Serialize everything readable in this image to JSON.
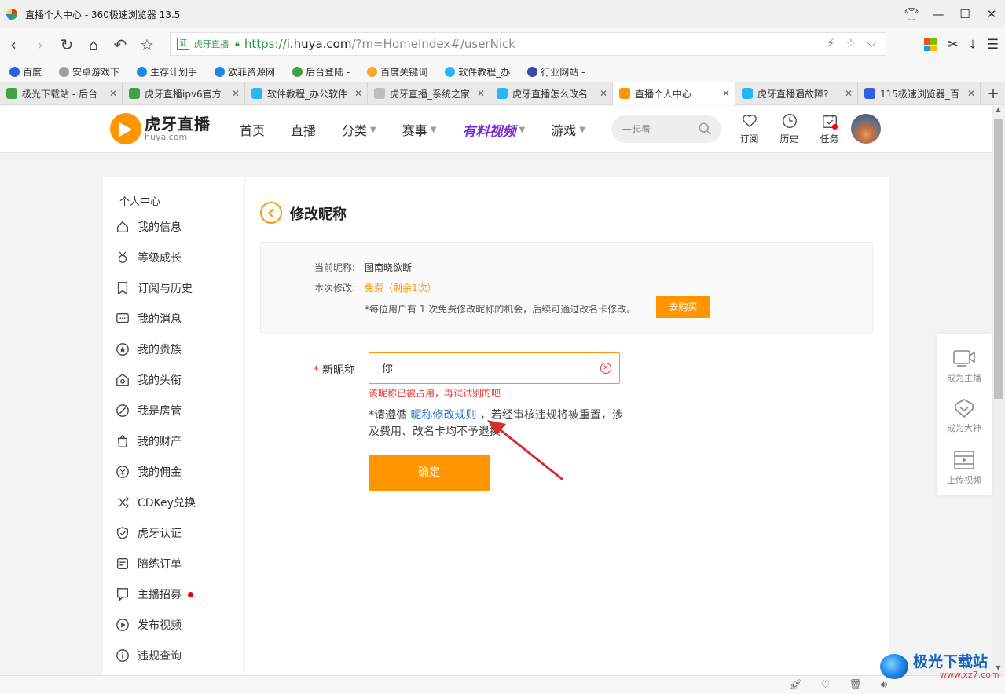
{
  "browser": {
    "title": "直播个人中心 - 360极速浏览器 13.5",
    "address": {
      "cert": "证",
      "site_name": "虎牙直播",
      "url_proto": "https://",
      "url_host": "i.huya.com",
      "url_path": "/?m=HomeIndex#/userNick"
    },
    "bookmarks": [
      {
        "label": "百度",
        "icon_color": "#2f5ee0"
      },
      {
        "label": "安卓游戏下",
        "icon_color": "#9e9e9e"
      },
      {
        "label": "生存计划手",
        "icon_color": "#1e88e5"
      },
      {
        "label": "欧菲资源网",
        "icon_color": "#1e88e5"
      },
      {
        "label": "后台登陆 -",
        "icon_color": "#43a047"
      },
      {
        "label": "百度关键词",
        "icon_color": "#f9a825"
      },
      {
        "label": "软件教程_办",
        "icon_color": "#29b6f6"
      },
      {
        "label": "行业网站 -",
        "icon_color": "#3949ab"
      }
    ],
    "tabs": [
      {
        "label": "极光下载站 - 后台",
        "icon_color": "#43a047",
        "active": false
      },
      {
        "label": "虎牙直播ipv6官方",
        "icon_color": "#43a047",
        "active": false
      },
      {
        "label": "软件教程_办公软件",
        "icon_color": "#29b6f6",
        "active": false
      },
      {
        "label": "虎牙直播_系统之家",
        "icon_color": "#bdbdbd",
        "active": false
      },
      {
        "label": "虎牙直播怎么改名",
        "icon_color": "#29b6f6",
        "active": false
      },
      {
        "label": "直播个人中心",
        "icon_color": "#ff9600",
        "active": true
      },
      {
        "label": "虎牙直播遇故障?",
        "icon_color": "#29b6f6",
        "active": false
      },
      {
        "label": "115极速浏览器_百",
        "icon_color": "#2f5ee0",
        "active": false
      }
    ],
    "new_tab": "+"
  },
  "site": {
    "logo_cn": "虎牙直播",
    "logo_en": "huya.com",
    "nav": [
      {
        "label": "首页",
        "dropdown": false,
        "special": false
      },
      {
        "label": "直播",
        "dropdown": false,
        "special": false
      },
      {
        "label": "分类",
        "dropdown": true,
        "special": false
      },
      {
        "label": "赛事",
        "dropdown": true,
        "special": false
      },
      {
        "label": "有料视频",
        "dropdown": true,
        "special": true
      },
      {
        "label": "游戏",
        "dropdown": true,
        "special": false
      }
    ],
    "search_placeholder": "一起看",
    "header_icons": [
      {
        "label": "订阅",
        "icon": "heart-icon"
      },
      {
        "label": "历史",
        "icon": "clock-icon"
      },
      {
        "label": "任务",
        "icon": "calendar-icon"
      }
    ]
  },
  "sidebar": {
    "title": "个人中心",
    "items": [
      {
        "label": "我的信息",
        "icon": "home-icon"
      },
      {
        "label": "等级成长",
        "icon": "medal-icon"
      },
      {
        "label": "订阅与历史",
        "icon": "bookmark-icon"
      },
      {
        "label": "我的消息",
        "icon": "message-icon"
      },
      {
        "label": "我的贵族",
        "icon": "star-icon"
      },
      {
        "label": "我的头衔",
        "icon": "title-icon"
      },
      {
        "label": "我是房管",
        "icon": "manager-icon"
      },
      {
        "label": "我的财产",
        "icon": "property-icon"
      },
      {
        "label": "我的佣金",
        "icon": "commission-icon"
      },
      {
        "label": "CDKey兑换",
        "icon": "shuffle-icon"
      },
      {
        "label": "虎牙认证",
        "icon": "shield-icon"
      },
      {
        "label": "陪练订单",
        "icon": "order-icon"
      },
      {
        "label": "主播招募",
        "icon": "recruit-icon",
        "dot": true
      },
      {
        "label": "发布视频",
        "icon": "play-icon"
      },
      {
        "label": "违规查询",
        "icon": "info-icon"
      }
    ]
  },
  "content": {
    "page_title": "修改昵称",
    "info": {
      "current_label": "当前昵称:",
      "current_value": "图南晓欲断",
      "this_label": "本次修改:",
      "this_value": "免费（剩余1次）",
      "note": "*每位用户有 1 次免费修改昵称的机会，后续可通过改名卡修改。",
      "buy_label": "去购买"
    },
    "form": {
      "required_mark": "*",
      "label": "新昵称",
      "value": "你",
      "error": "该昵称已被占用，再试试别的吧",
      "rule_prefix": "*请遵循",
      "rule_link": "昵称修改规则",
      "rule_suffix": "，若经审核违规将被重置，涉及费用、改名卡均不予退换",
      "confirm_label": "确定"
    },
    "annotation_color": "#d32f2f"
  },
  "float_panel": [
    {
      "label": "成为主播",
      "icon": "camera-icon"
    },
    {
      "label": "成为大神",
      "icon": "badge-icon"
    },
    {
      "label": "上传视频",
      "icon": "upload-video-icon"
    }
  ],
  "watermark": {
    "cn": "极光下载站",
    "en": "www.xz7.com"
  },
  "colors": {
    "accent": "#ff9600",
    "error": "#ee3333",
    "link": "#2c73d2"
  }
}
